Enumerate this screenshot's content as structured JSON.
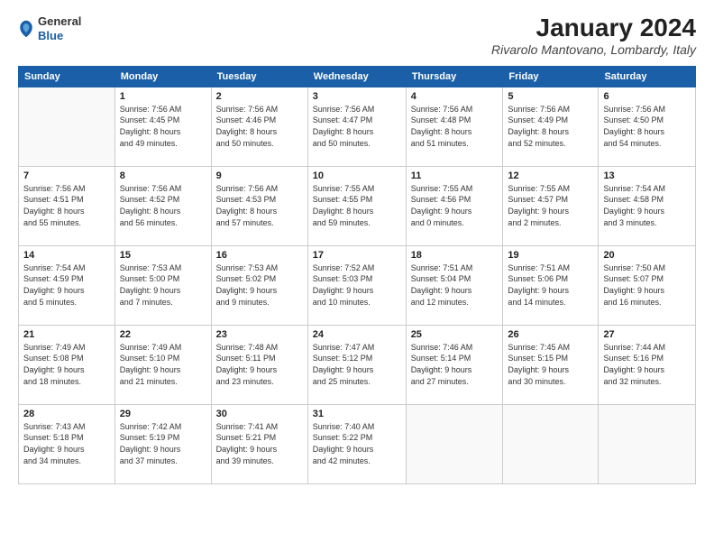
{
  "header": {
    "logo": {
      "general": "General",
      "blue": "Blue"
    },
    "title": "January 2024",
    "location": "Rivarolo Mantovano, Lombardy, Italy"
  },
  "weekdays": [
    "Sunday",
    "Monday",
    "Tuesday",
    "Wednesday",
    "Thursday",
    "Friday",
    "Saturday"
  ],
  "weeks": [
    [
      {
        "day": "",
        "info": ""
      },
      {
        "day": "1",
        "info": "Sunrise: 7:56 AM\nSunset: 4:45 PM\nDaylight: 8 hours\nand 49 minutes."
      },
      {
        "day": "2",
        "info": "Sunrise: 7:56 AM\nSunset: 4:46 PM\nDaylight: 8 hours\nand 50 minutes."
      },
      {
        "day": "3",
        "info": "Sunrise: 7:56 AM\nSunset: 4:47 PM\nDaylight: 8 hours\nand 50 minutes."
      },
      {
        "day": "4",
        "info": "Sunrise: 7:56 AM\nSunset: 4:48 PM\nDaylight: 8 hours\nand 51 minutes."
      },
      {
        "day": "5",
        "info": "Sunrise: 7:56 AM\nSunset: 4:49 PM\nDaylight: 8 hours\nand 52 minutes."
      },
      {
        "day": "6",
        "info": "Sunrise: 7:56 AM\nSunset: 4:50 PM\nDaylight: 8 hours\nand 54 minutes."
      }
    ],
    [
      {
        "day": "7",
        "info": "Sunrise: 7:56 AM\nSunset: 4:51 PM\nDaylight: 8 hours\nand 55 minutes."
      },
      {
        "day": "8",
        "info": "Sunrise: 7:56 AM\nSunset: 4:52 PM\nDaylight: 8 hours\nand 56 minutes."
      },
      {
        "day": "9",
        "info": "Sunrise: 7:56 AM\nSunset: 4:53 PM\nDaylight: 8 hours\nand 57 minutes."
      },
      {
        "day": "10",
        "info": "Sunrise: 7:55 AM\nSunset: 4:55 PM\nDaylight: 8 hours\nand 59 minutes."
      },
      {
        "day": "11",
        "info": "Sunrise: 7:55 AM\nSunset: 4:56 PM\nDaylight: 9 hours\nand 0 minutes."
      },
      {
        "day": "12",
        "info": "Sunrise: 7:55 AM\nSunset: 4:57 PM\nDaylight: 9 hours\nand 2 minutes."
      },
      {
        "day": "13",
        "info": "Sunrise: 7:54 AM\nSunset: 4:58 PM\nDaylight: 9 hours\nand 3 minutes."
      }
    ],
    [
      {
        "day": "14",
        "info": "Sunrise: 7:54 AM\nSunset: 4:59 PM\nDaylight: 9 hours\nand 5 minutes."
      },
      {
        "day": "15",
        "info": "Sunrise: 7:53 AM\nSunset: 5:00 PM\nDaylight: 9 hours\nand 7 minutes."
      },
      {
        "day": "16",
        "info": "Sunrise: 7:53 AM\nSunset: 5:02 PM\nDaylight: 9 hours\nand 9 minutes."
      },
      {
        "day": "17",
        "info": "Sunrise: 7:52 AM\nSunset: 5:03 PM\nDaylight: 9 hours\nand 10 minutes."
      },
      {
        "day": "18",
        "info": "Sunrise: 7:51 AM\nSunset: 5:04 PM\nDaylight: 9 hours\nand 12 minutes."
      },
      {
        "day": "19",
        "info": "Sunrise: 7:51 AM\nSunset: 5:06 PM\nDaylight: 9 hours\nand 14 minutes."
      },
      {
        "day": "20",
        "info": "Sunrise: 7:50 AM\nSunset: 5:07 PM\nDaylight: 9 hours\nand 16 minutes."
      }
    ],
    [
      {
        "day": "21",
        "info": "Sunrise: 7:49 AM\nSunset: 5:08 PM\nDaylight: 9 hours\nand 18 minutes."
      },
      {
        "day": "22",
        "info": "Sunrise: 7:49 AM\nSunset: 5:10 PM\nDaylight: 9 hours\nand 21 minutes."
      },
      {
        "day": "23",
        "info": "Sunrise: 7:48 AM\nSunset: 5:11 PM\nDaylight: 9 hours\nand 23 minutes."
      },
      {
        "day": "24",
        "info": "Sunrise: 7:47 AM\nSunset: 5:12 PM\nDaylight: 9 hours\nand 25 minutes."
      },
      {
        "day": "25",
        "info": "Sunrise: 7:46 AM\nSunset: 5:14 PM\nDaylight: 9 hours\nand 27 minutes."
      },
      {
        "day": "26",
        "info": "Sunrise: 7:45 AM\nSunset: 5:15 PM\nDaylight: 9 hours\nand 30 minutes."
      },
      {
        "day": "27",
        "info": "Sunrise: 7:44 AM\nSunset: 5:16 PM\nDaylight: 9 hours\nand 32 minutes."
      }
    ],
    [
      {
        "day": "28",
        "info": "Sunrise: 7:43 AM\nSunset: 5:18 PM\nDaylight: 9 hours\nand 34 minutes."
      },
      {
        "day": "29",
        "info": "Sunrise: 7:42 AM\nSunset: 5:19 PM\nDaylight: 9 hours\nand 37 minutes."
      },
      {
        "day": "30",
        "info": "Sunrise: 7:41 AM\nSunset: 5:21 PM\nDaylight: 9 hours\nand 39 minutes."
      },
      {
        "day": "31",
        "info": "Sunrise: 7:40 AM\nSunset: 5:22 PM\nDaylight: 9 hours\nand 42 minutes."
      },
      {
        "day": "",
        "info": ""
      },
      {
        "day": "",
        "info": ""
      },
      {
        "day": "",
        "info": ""
      }
    ]
  ]
}
